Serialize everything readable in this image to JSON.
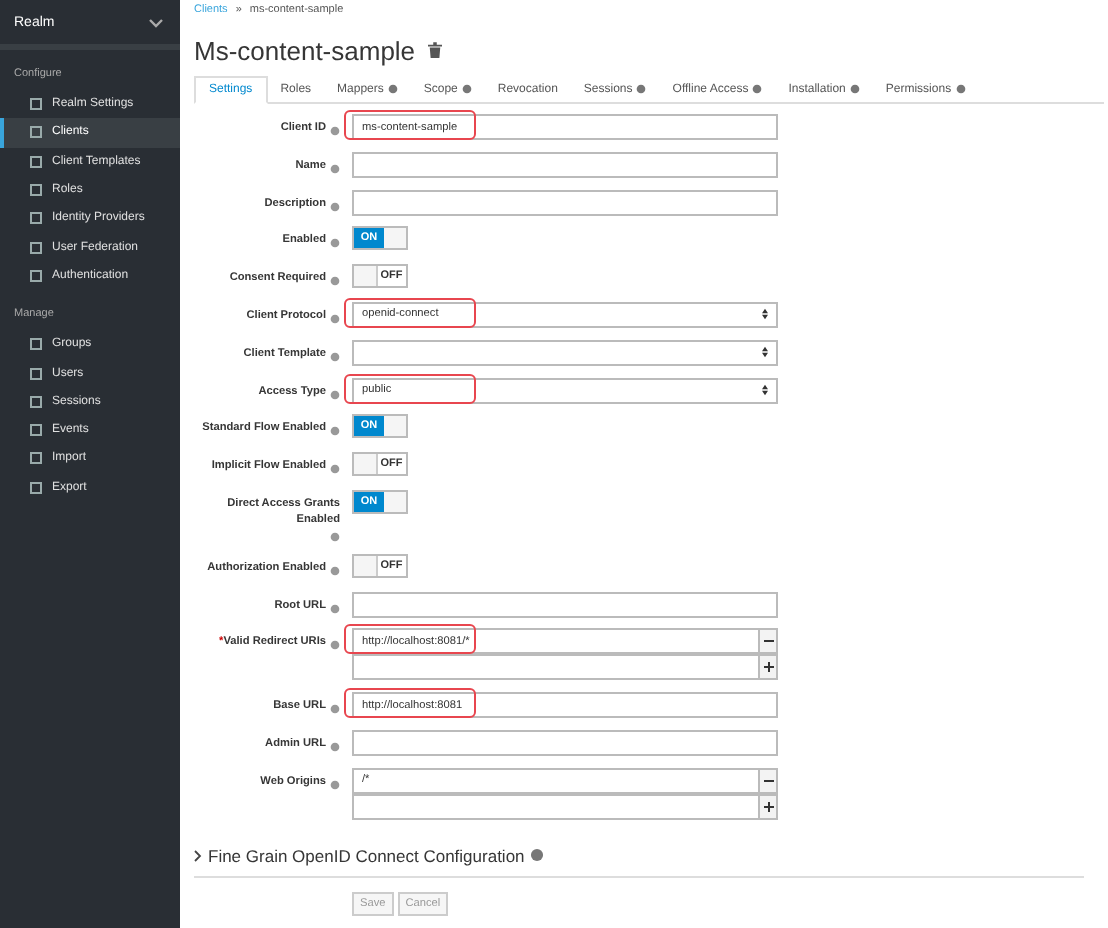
{
  "sidebar": {
    "realm": "Realm",
    "sections": [
      {
        "title": "Configure",
        "items": [
          {
            "label": "Realm Settings",
            "selected": false
          },
          {
            "label": "Clients",
            "selected": true
          },
          {
            "label": "Client Templates",
            "selected": false
          },
          {
            "label": "Roles",
            "selected": false
          },
          {
            "label": "Identity Providers",
            "selected": false
          },
          {
            "label": "User Federation",
            "selected": false
          },
          {
            "label": "Authentication",
            "selected": false
          }
        ]
      },
      {
        "title": "Manage",
        "items": [
          {
            "label": "Groups",
            "selected": false
          },
          {
            "label": "Users",
            "selected": false
          },
          {
            "label": "Sessions",
            "selected": false
          },
          {
            "label": "Events",
            "selected": false
          },
          {
            "label": "Import",
            "selected": false
          },
          {
            "label": "Export",
            "selected": false
          }
        ]
      }
    ]
  },
  "breadcrumb": {
    "items": [
      "Clients",
      "ms-content-sample"
    ],
    "separator": "»"
  },
  "title": "Ms-content-sample",
  "tabs": [
    {
      "label": "Settings",
      "selected": true,
      "help": false
    },
    {
      "label": "Roles",
      "selected": false,
      "help": false
    },
    {
      "label": "Mappers",
      "selected": false,
      "help": true
    },
    {
      "label": "Scope",
      "selected": false,
      "help": true
    },
    {
      "label": "Revocation",
      "selected": false,
      "help": false
    },
    {
      "label": "Sessions",
      "selected": false,
      "help": true
    },
    {
      "label": "Offline Access",
      "selected": false,
      "help": true
    },
    {
      "label": "Installation",
      "selected": false,
      "help": true
    },
    {
      "label": "Permissions",
      "selected": false,
      "help": true
    }
  ],
  "fields": [
    {
      "kind": "text",
      "label": "Client ID",
      "value": "ms-content-sample",
      "highlighted": true
    },
    {
      "kind": "text",
      "label": "Name",
      "highlighted": false
    },
    {
      "kind": "text",
      "label": "Description",
      "highlighted": false
    },
    {
      "kind": "toggle",
      "label": "Enabled",
      "on": true,
      "toggle_text": "ON"
    },
    {
      "kind": "toggle",
      "label": "Consent Required",
      "on": false,
      "toggle_text": "OFF"
    },
    {
      "kind": "select",
      "label": "Client Protocol",
      "value": "openid-connect",
      "highlighted": true
    },
    {
      "kind": "select",
      "label": "Client Template",
      "highlighted": false
    },
    {
      "kind": "select",
      "label": "Access Type",
      "value": "public",
      "highlighted": true
    },
    {
      "kind": "toggle",
      "label": "Standard Flow Enabled",
      "on": true,
      "toggle_text": "ON"
    },
    {
      "kind": "toggle",
      "label": "Implicit Flow Enabled",
      "on": false,
      "toggle_text": "OFF"
    },
    {
      "kind": "toggle",
      "label": "Direct Access Grants Enabled",
      "on": true,
      "toggle_text": "ON"
    },
    {
      "kind": "toggle",
      "label": "Authorization Enabled",
      "on": false,
      "toggle_text": "OFF"
    },
    {
      "kind": "text",
      "label": "Root URL",
      "highlighted": false
    },
    {
      "kind": "multi",
      "label": "Valid Redirect URIs",
      "required_mark": "*",
      "values": [
        "http://localhost:8081/*"
      ],
      "highlighted": true
    },
    {
      "kind": "text",
      "label": "Base URL",
      "value": "http://localhost:8081",
      "highlighted": true
    },
    {
      "kind": "text",
      "label": "Admin URL",
      "highlighted": false
    },
    {
      "kind": "multi",
      "label": "Web Origins",
      "values": [
        "/*"
      ],
      "highlighted": false
    }
  ],
  "section": {
    "label": "Fine Grain OpenID Connect Configuration",
    "expanded": false
  },
  "buttons": [
    {
      "label": "Save",
      "disabled": true
    },
    {
      "label": "Cancel",
      "disabled": true
    }
  ]
}
